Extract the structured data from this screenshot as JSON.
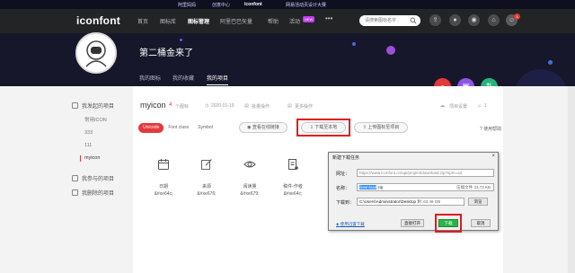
{
  "topbar": {
    "items": [
      "阿里妈妈",
      "创意中心",
      "iconfont",
      "网易活动页设计大赛"
    ]
  },
  "header": {
    "brand": "iconfont",
    "nav": [
      "首页",
      "图标库",
      "图标管理",
      "阿里巴巴矢量",
      "帮助",
      "活动"
    ],
    "new_badge": "NEW",
    "more": "•••",
    "search_placeholder": "请搜索图标名字",
    "notification_count": "3"
  },
  "hero": {
    "title": "第二桶金来了",
    "tabs": [
      "我的图标",
      "我的收藏",
      "我的项目"
    ]
  },
  "sidebar": {
    "my_projects": "我发起的项目",
    "projects": [
      "常用ICON",
      "333",
      "111",
      "myicon"
    ],
    "joined": "我参与的项目",
    "deleted": "我删除的项目"
  },
  "main": {
    "project_name": "myicon",
    "icon_count": "4",
    "icon_count_unit": "个图标",
    "date": "2020-01-19",
    "batch_op": "批量操作",
    "more_op": "更多操作",
    "settings": "项目设置",
    "member_count": "1",
    "tabs": [
      "Unicode",
      "Font class",
      "Symbol"
    ],
    "view_online": "查看在线链接",
    "download_local": "下载至本地",
    "upload_icon": "上传图标至项目",
    "help": "使用帮助",
    "glyphs": [
      {
        "label": "日期",
        "code": "&#xe64c;"
      },
      {
        "label": "来源",
        "code": "&#xe676;"
      },
      {
        "label": "阅读量",
        "code": "&#xe679;"
      },
      {
        "label": "稿件-作者",
        "code": "&#xe64c;"
      }
    ]
  },
  "dialog": {
    "title": "新建下载任务",
    "url_label": "网址：",
    "url": "https://www.iconfont.cn/api/project/download.zip?spm=a3",
    "name_label": "名称：",
    "filename_selected": "download",
    "filename_ext": ".zip",
    "size": "压缩文件 23.73 KB",
    "path_label": "下载到：",
    "path": "C:\\Users\\Administrator\\Desktop",
    "free_space": "剩: 63.49 GB",
    "browse": "浏览",
    "use_thunder": "使用迅雷下载",
    "open_direct": "直接打开",
    "download": "下载",
    "cancel": "取消"
  }
}
